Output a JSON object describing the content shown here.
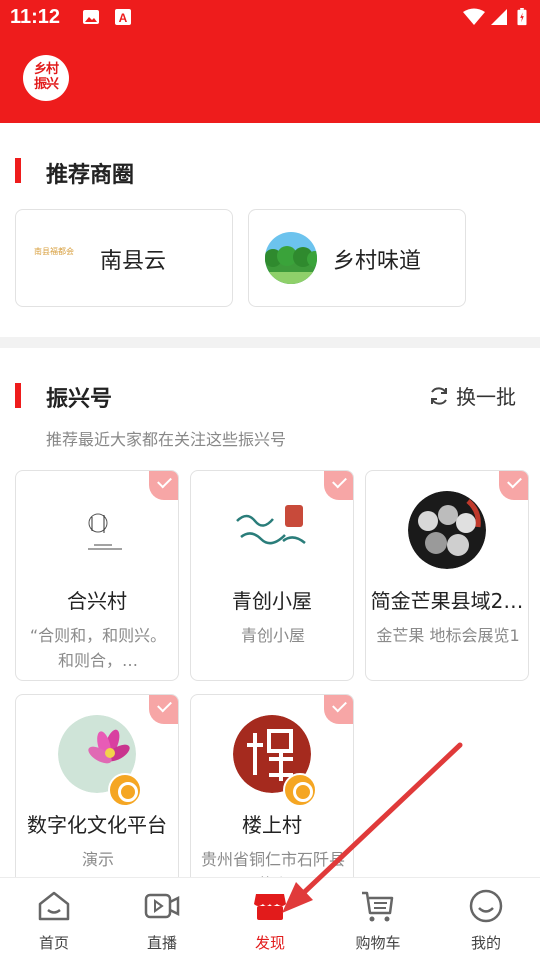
{
  "status_bar": {
    "time": "11:12"
  },
  "header": {
    "logo_text_line1": "乡村",
    "logo_text_line2": "振兴"
  },
  "recommended_circles": {
    "title": "推荐商圈",
    "items": [
      {
        "name": "南县云",
        "logo_text": "南县福都会"
      },
      {
        "name": "乡村味道"
      }
    ]
  },
  "revival_accounts": {
    "title": "振兴号",
    "refresh_label": "换一批",
    "subtitle": "推荐最近大家都在关注这些振兴号",
    "items": [
      {
        "name": "合兴村",
        "desc": "“合则和，和则兴。和则合，…"
      },
      {
        "name": "青创小屋",
        "desc": "青创小屋"
      },
      {
        "name": "简金芒果县域2…",
        "desc": "金芒果 地标会展览1"
      },
      {
        "name": "数字化文化平台",
        "desc": "演示"
      },
      {
        "name": "楼上村",
        "desc": "贵州省铜仁市石阡县国荣乡…"
      }
    ]
  },
  "bottom_nav": {
    "items": [
      {
        "label": "首页"
      },
      {
        "label": "直播"
      },
      {
        "label": "发现"
      },
      {
        "label": "购物车"
      },
      {
        "label": "我的"
      }
    ]
  },
  "colors": {
    "brand_red": "#ee1c1c",
    "badge_orange": "#f5a623",
    "check_pink": "#f7a6a6"
  }
}
